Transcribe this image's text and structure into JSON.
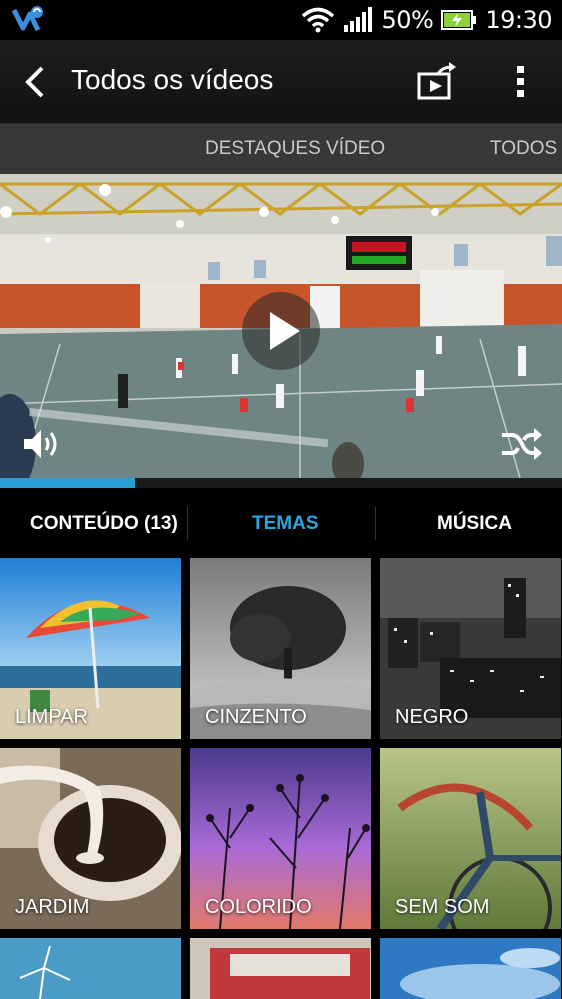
{
  "status_bar": {
    "battery": "50%",
    "time": "19:30"
  },
  "action_bar": {
    "title": "Todos os vídeos"
  },
  "sub_tabs": {
    "highlights": "DESTAQUES VÍDEO",
    "all": "TODOS"
  },
  "video": {
    "progress_fraction": 0.24
  },
  "tabs": [
    {
      "label": "CONTEÚDO (13)",
      "active": false
    },
    {
      "label": "TEMAS",
      "active": true
    },
    {
      "label": "MÚSICA",
      "active": false
    }
  ],
  "themes": [
    {
      "label": "LIMPAR"
    },
    {
      "label": "CINZENTO"
    },
    {
      "label": "NEGRO"
    },
    {
      "label": "JARDIM"
    },
    {
      "label": "COLORIDO"
    },
    {
      "label": "SEM SOM"
    }
  ],
  "colors": {
    "accent": "#2aa7e0",
    "progress": "#2a9fd6"
  }
}
